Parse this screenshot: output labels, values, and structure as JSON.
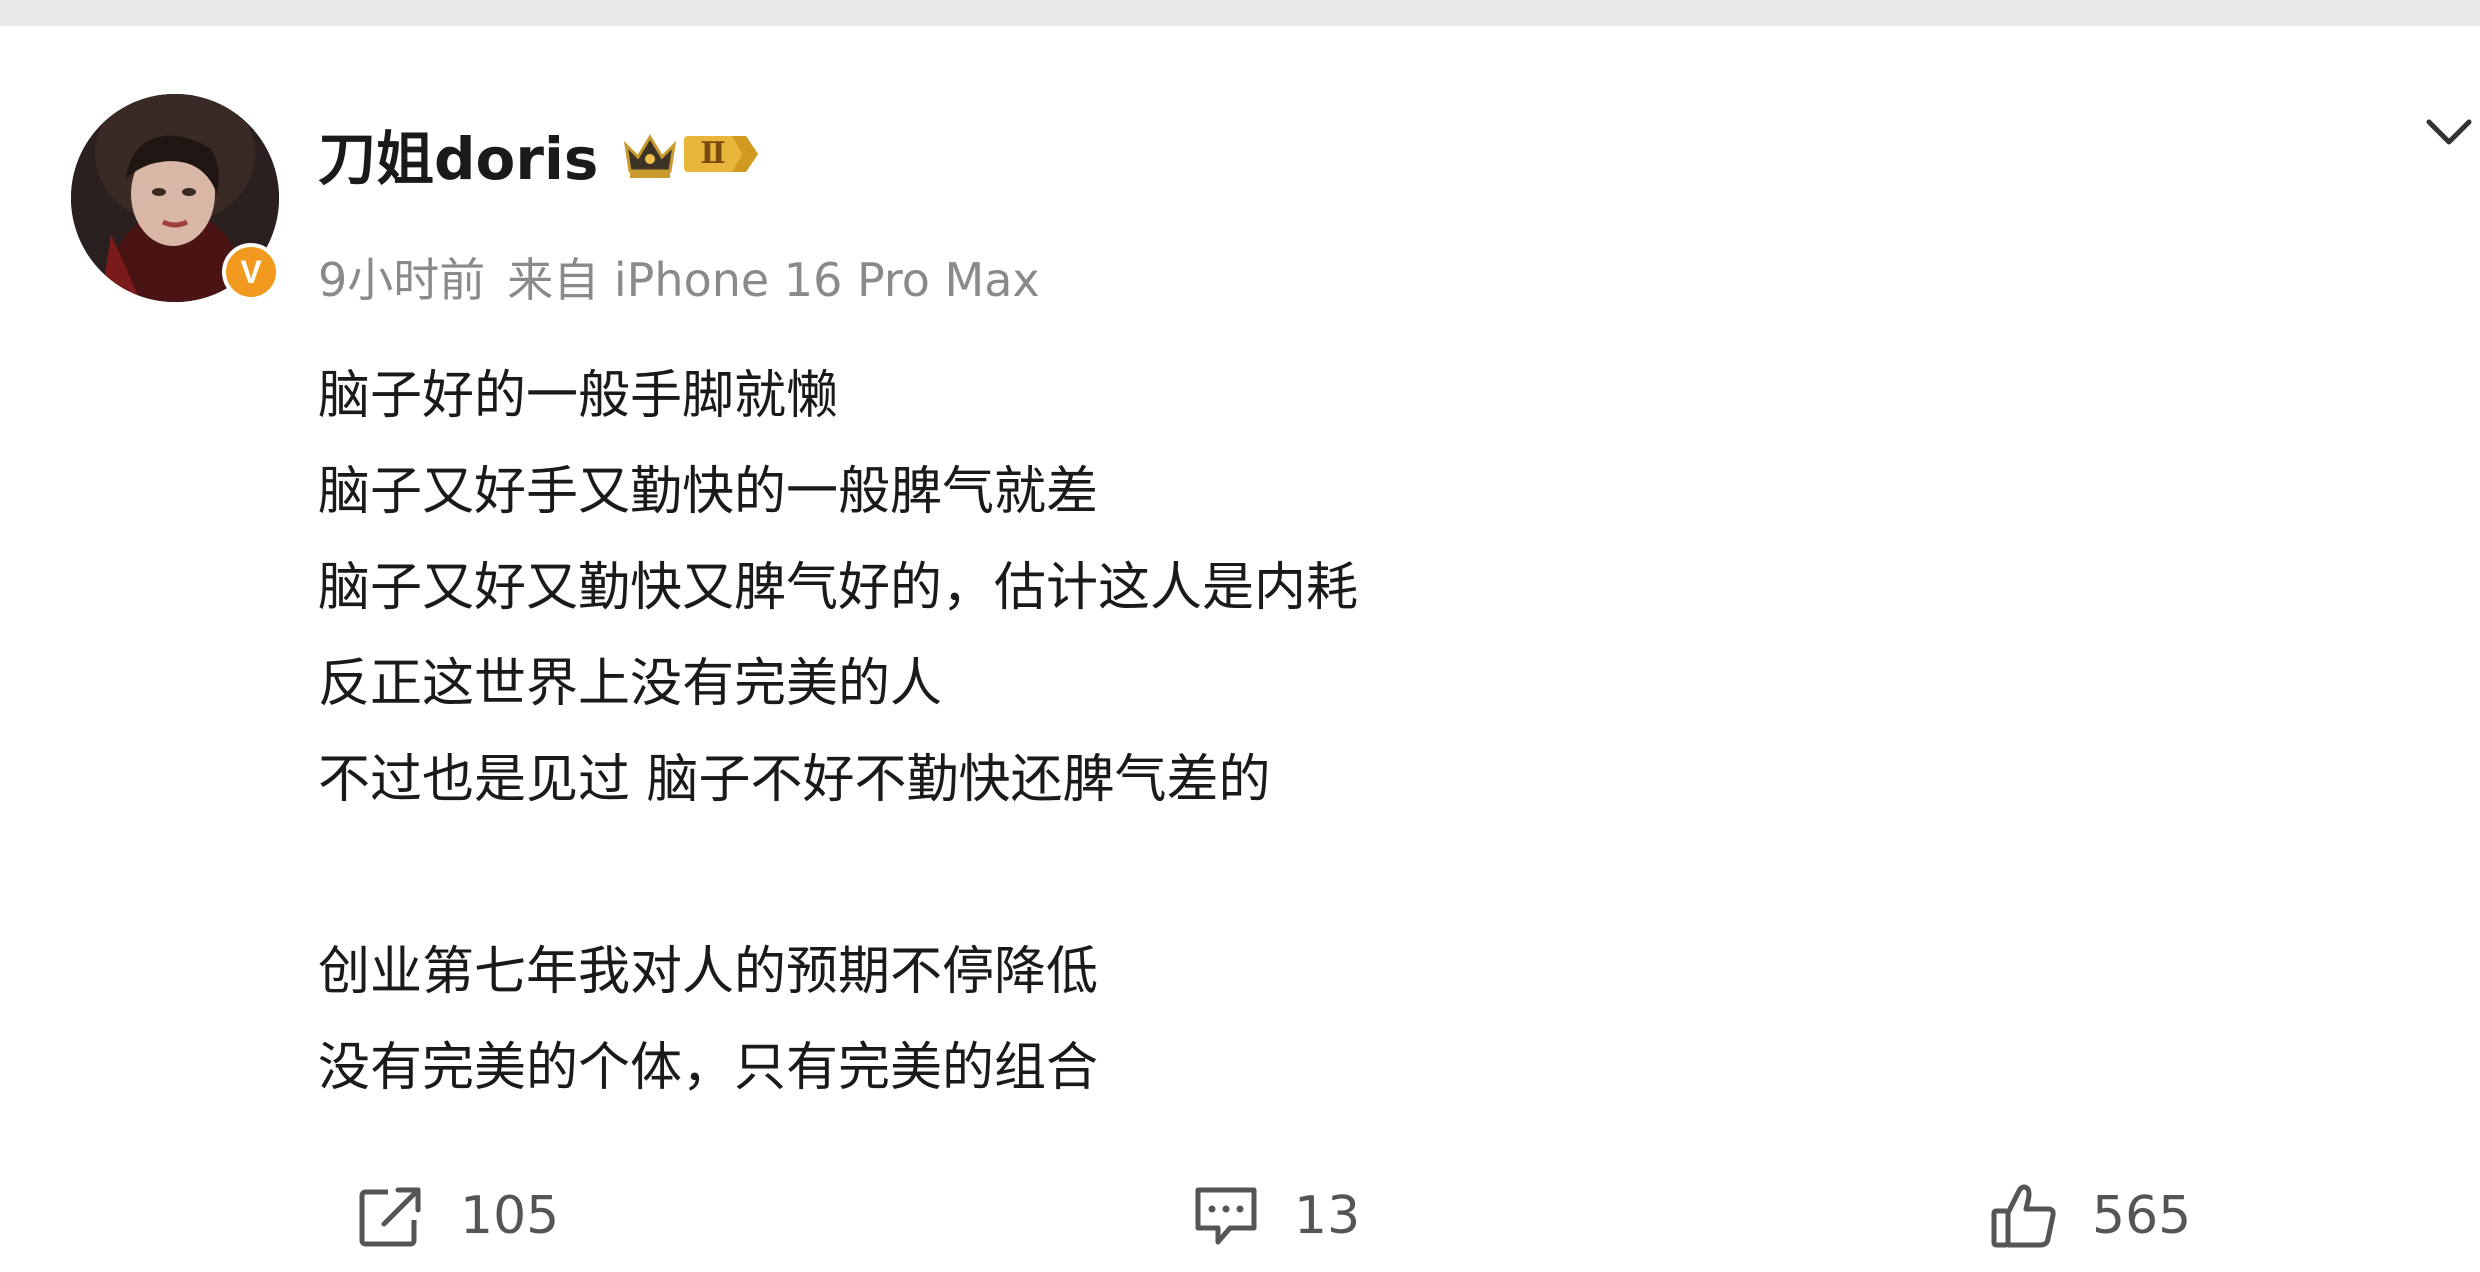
{
  "post": {
    "author": {
      "name": "刀姐doris",
      "verified_badge": "V",
      "level_badge": "Ⅱ",
      "icons": [
        "crown-icon",
        "level-badge-icon"
      ]
    },
    "meta": {
      "time": "9小时前",
      "source": "来自 iPhone 16 Pro Max"
    },
    "content_lines": [
      "脑子好的一般手脚就懒",
      "脑子又好手又勤快的一般脾气就差",
      "脑子又好又勤快又脾气好的，估计这人是内耗",
      "反正这世界上没有完美的人",
      "不过也是见过 脑子不好不勤快还脾气差的",
      "",
      "创业第七年我对人的预期不停降低",
      "没有完美的个体，只有完美的组合"
    ],
    "actions": {
      "repost": {
        "icon": "share-icon",
        "count": "105"
      },
      "comment": {
        "icon": "comment-icon",
        "count": "13"
      },
      "like": {
        "icon": "thumbs-up-icon",
        "count": "565"
      }
    },
    "colors": {
      "text": "#1a1a1a",
      "meta": "#8a8a8a",
      "verified": "#f29a1f",
      "level_badge": "#e8b63a",
      "action_text": "#555555"
    }
  }
}
